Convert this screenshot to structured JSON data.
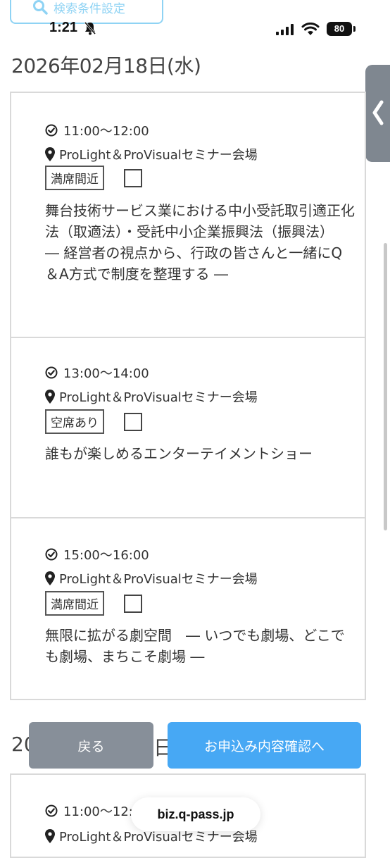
{
  "search": {
    "label": "検索条件設定"
  },
  "status_bar": {
    "time": "1:21",
    "battery": "80"
  },
  "date_heading": "2026年02月18日(水)",
  "sessions": [
    {
      "time": "11:00〜12:00",
      "location": "ProLight＆ProVisualセミナー会場",
      "availability": "満席間近",
      "title": "舞台技術サービス業における中小受託取引適正化法（取適法）・受託中小企業振興法（振興法）　 ― 経営者の視点から、行政の皆さんと一緒にQ＆A方式で制度を整理する ―"
    },
    {
      "time": "13:00〜14:00",
      "location": "ProLight＆ProVisualセミナー会場",
      "availability": "空席あり",
      "title": "誰もが楽しめるエンターテイメントショー"
    },
    {
      "time": "15:00〜16:00",
      "location": "ProLight＆ProVisualセミナー会場",
      "availability": "満席間近",
      "title": "無限に拡がる劇空間　― いつでも劇場、どこでも劇場、まちこそ劇場 ―"
    }
  ],
  "next_date_heading": {
    "prefix": "20",
    "suffix": "日"
  },
  "next_session": {
    "time": "11:00〜12:",
    "location": "ProLight＆ProVisualセミナー会場"
  },
  "buttons": {
    "back": "戻る",
    "confirm": "お申込み内容確認へ"
  },
  "browser": {
    "url": "biz.q-pass.jp"
  }
}
